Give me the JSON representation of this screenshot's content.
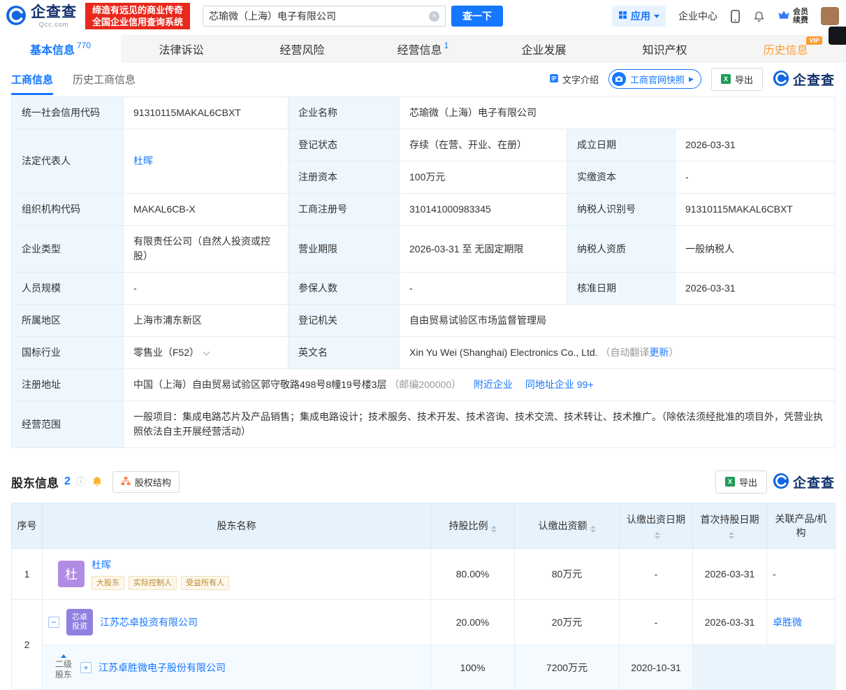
{
  "header": {
    "logo": {
      "name": "企查查",
      "domain": "Qcc.com"
    },
    "banner": {
      "line1": "缔造有远见的商业传奇",
      "line2": "全国企业信用查询系统"
    },
    "search": {
      "value": "芯瑜微（上海）电子有限公司",
      "button": "查一下"
    },
    "nav": {
      "apps": "应用",
      "enterprise_center": "企业中心",
      "member_line1": "会员",
      "member_line2": "续费"
    }
  },
  "tabs": [
    {
      "label": "基本信息",
      "count": "770"
    },
    {
      "label": "法律诉讼",
      "count": ""
    },
    {
      "label": "经营风险",
      "count": ""
    },
    {
      "label": "经营信息",
      "count": "1"
    },
    {
      "label": "企业发展",
      "count": ""
    },
    {
      "label": "知识产权",
      "count": ""
    },
    {
      "label": "历史信息",
      "count": "",
      "badge": "VIP"
    }
  ],
  "toolbar": {
    "subtab_active": "工商信息",
    "subtab_history": "历史工商信息",
    "text_intro": "文字介绍",
    "snapshot": "工商官网快照",
    "snapshot_arrow": "▶",
    "export": "导出",
    "brand": "企查查"
  },
  "business_info": {
    "credit_code_label": "统一社会信用代码",
    "credit_code": "91310115MAKAL6CBXT",
    "company_name_label": "企业名称",
    "company_name": "芯瑜微（上海）电子有限公司",
    "legal_rep_label": "法定代表人",
    "legal_rep": "杜晖",
    "reg_status_label": "登记状态",
    "reg_status": "存续（在营、开业、在册）",
    "establish_date_label": "成立日期",
    "establish_date": "2026-03-31",
    "reg_capital_label": "注册资本",
    "reg_capital": "100万元",
    "paid_capital_label": "实缴资本",
    "paid_capital": "-",
    "org_code_label": "组织机构代码",
    "org_code": "MAKAL6CB-X",
    "reg_number_label": "工商注册号",
    "reg_number": "310141000983345",
    "taxpayer_id_label": "纳税人识别号",
    "taxpayer_id": "91310115MAKAL6CBXT",
    "company_type_label": "企业类型",
    "company_type": "有限责任公司（自然人投资或控股）",
    "business_term_label": "营业期限",
    "business_term": "2026-03-31 至 无固定期限",
    "taxpayer_quality_label": "纳税人资质",
    "taxpayer_quality": "一般纳税人",
    "staff_size_label": "人员规模",
    "staff_size": "-",
    "insured_count_label": "参保人数",
    "insured_count": "-",
    "approval_date_label": "核准日期",
    "approval_date": "2026-03-31",
    "region_label": "所属地区",
    "region": "上海市浦东新区",
    "reg_authority_label": "登记机关",
    "reg_authority": "自由贸易试验区市场监督管理局",
    "industry_label": "国标行业",
    "industry": "零售业（F52）",
    "en_name_label": "英文名",
    "en_name": "Xin Yu Wei (Shanghai) Electronics Co., Ltd.",
    "en_name_note": "（自动翻译",
    "en_name_update": "更新",
    "en_name_note_end": "）",
    "address_label": "注册地址",
    "address": "中国（上海）自由贸易试验区郭守敬路498号8幢19号楼3层",
    "address_postcode": "（邮编200000）",
    "nearby_link": "附近企业",
    "same_address_link": "同地址企业 99+",
    "scope_label": "经营范围",
    "scope": "一般项目：集成电路芯片及产品销售；集成电路设计；技术服务、技术开发、技术咨询、技术交流、技术转让、技术推广。（除依法须经批准的项目外，凭营业执照依法自主开展经营活动）"
  },
  "shareholders": {
    "title": "股东信息",
    "count": "2",
    "equity_structure": "股权结构",
    "export": "导出",
    "brand": "企查查",
    "columns": {
      "no": "序号",
      "name": "股东名称",
      "ratio": "持股比例",
      "amount": "认缴出资额",
      "date": "认缴出资日期",
      "first_date": "首次持股日期",
      "related": "关联产品/机构"
    },
    "row1": {
      "no": "1",
      "avatar": "杜",
      "name": "杜晖",
      "tags": [
        "大股东",
        "实际控制人",
        "受益所有人"
      ],
      "ratio": "80.00%",
      "amount": "80万元",
      "date": "-",
      "first_date": "2026-03-31",
      "related": "-"
    },
    "row2": {
      "no": "2",
      "avatar_line1": "芯卓",
      "avatar_line2": "投资",
      "name": "江苏芯卓投资有限公司",
      "ratio": "20.00%",
      "amount": "20万元",
      "date": "-",
      "first_date": "2026-03-31",
      "related": "卓胜微"
    },
    "row2_child": {
      "level_line1": "二级",
      "level_line2": "股东",
      "name": "江苏卓胜微电子股份有限公司",
      "ratio": "100%",
      "amount": "7200万元",
      "date": "2020-10-31"
    }
  }
}
